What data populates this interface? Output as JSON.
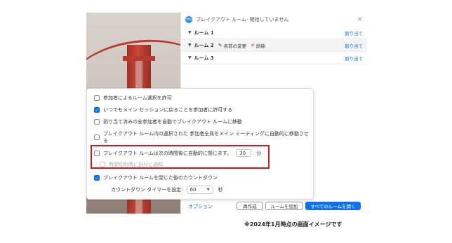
{
  "window": {
    "title": "ブレイクアウト ルーム- 開始していません"
  },
  "rooms": [
    {
      "name": "ルーム 1",
      "assign_label": "割り当て"
    },
    {
      "name": "ルーム 2",
      "rename_label": "名前の変更",
      "delete_label": "削除",
      "assign_label": "割り当て"
    },
    {
      "name": "ルーム 3",
      "assign_label": "割り当て"
    }
  ],
  "options": {
    "allow_choose": {
      "label": "参加者によるルーム選択を許可",
      "checked": false
    },
    "allow_return": {
      "label": "いつでもメイン セッションに戻ることを参加者に許可する",
      "checked": true
    },
    "auto_move": {
      "label": "割り当て済みの全参加者を自動でブレイクアウト ルームに移動",
      "checked": false
    },
    "auto_move_main": {
      "label": "ブレイクアウト ルーム内の選択された 参加者全員をメイン ミーティングに自動的に移動させる",
      "checked": false
    },
    "auto_close": {
      "label": "ブレイクアウト ルームは次の時間後に自動的に閉じます。",
      "checked": false,
      "value": "30",
      "unit": "分"
    },
    "notify_me": {
      "label": "時間切れ時に自分に通知",
      "checked": false
    },
    "countdown": {
      "label": "ブレイクアウト ルームを閉じた後のカウントダウン",
      "checked": true
    },
    "countdown_timer": {
      "label": "カウントダウン タイマーを設定:",
      "value": "60",
      "unit": "秒"
    }
  },
  "footer": {
    "options_link": "オプション",
    "recreate": "再作成",
    "add_room": "ルームを追加",
    "open_all": "すべてのルームを開く"
  },
  "caption": "※2024年1月時点の画面イメージです",
  "colors": {
    "accent": "#0e71eb",
    "highlight": "#d0191b",
    "delete": "#d93025"
  }
}
